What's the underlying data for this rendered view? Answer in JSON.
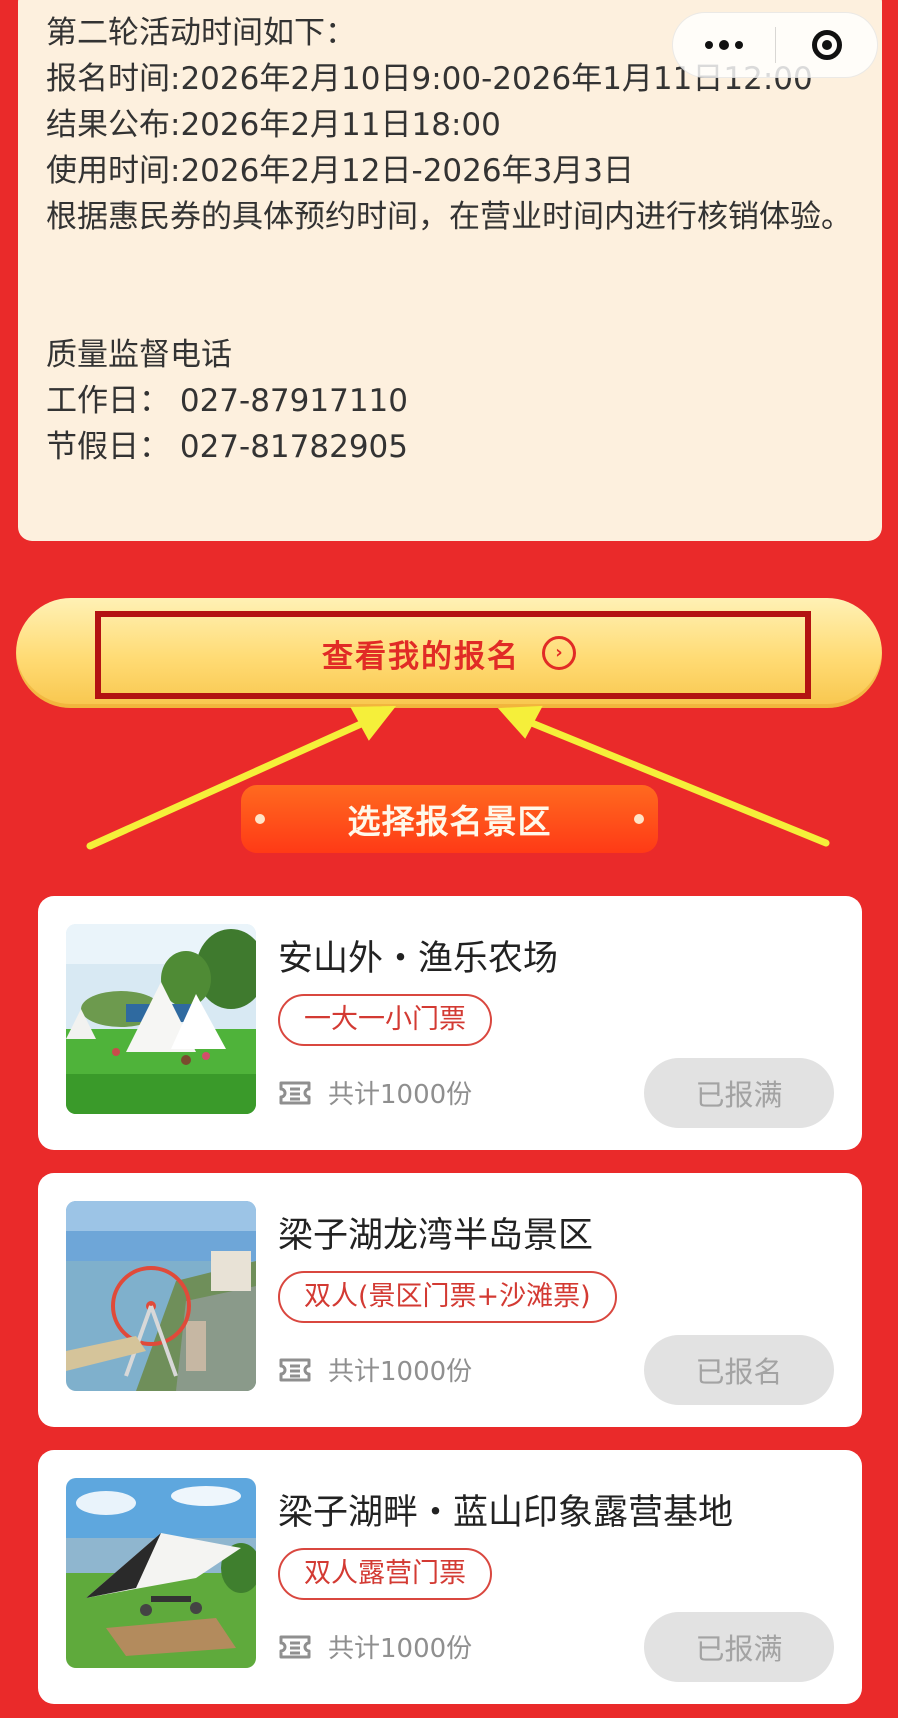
{
  "notice": {
    "lines": [
      "第二轮活动时间如下：",
      "报名时间:2026年2月10日9:00-2026年1月11日12:00",
      "结果公布:2026年2月11日18:00",
      "使用时间:2026年2月12日-2026年3月3日",
      "根据惠民券的具体预约时间，在营业时间内进行核销体验。"
    ],
    "supervision_title": "质量监督电话",
    "workday": "工作日：  027-87917110",
    "holiday": "节假日：  027-81782905"
  },
  "my_signup_button": {
    "label": "查看我的报名",
    "icon": "chevron-right-circle-icon"
  },
  "section_title": "选择报名景区",
  "spots": [
    {
      "name": "安山外・渔乐农场",
      "tag": "一大一小门票",
      "count": "共计1000份",
      "status": "已报满"
    },
    {
      "name": "梁子湖龙湾半岛景区",
      "tag": "双人(景区门票+沙滩票)",
      "count": "共计1000份",
      "status": "已报名"
    },
    {
      "name": "梁子湖畔・蓝山印象露营基地",
      "tag": "双人露营门票",
      "count": "共计1000份",
      "status": "已报满"
    }
  ],
  "colors": {
    "background": "#ea2a2a",
    "notice_bg": "#fdf0de",
    "button_text": "#e12b26",
    "annotation_box": "#b31212",
    "annotation_arrow": "#f5ef3a",
    "status_bg": "#e2e2e2"
  }
}
